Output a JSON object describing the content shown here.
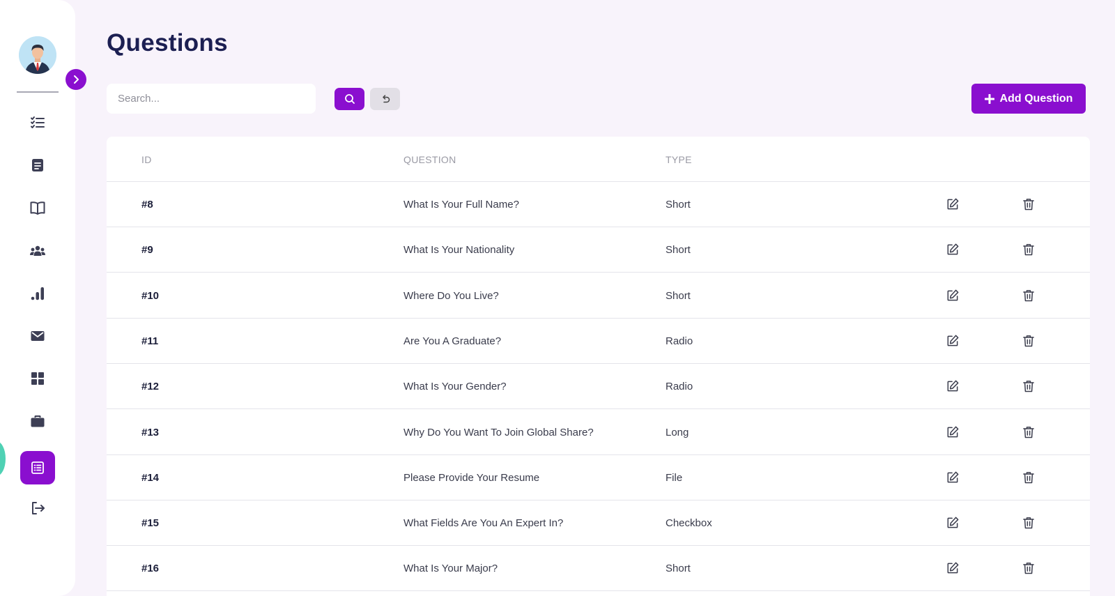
{
  "page": {
    "title": "Questions"
  },
  "search": {
    "placeholder": "Search..."
  },
  "toolbar": {
    "add_label": "Add Question"
  },
  "colors": {
    "accent": "#8a0fcf",
    "title": "#1c1f52",
    "background": "#f8f3fb"
  },
  "sidebar": {
    "items": [
      {
        "icon": "checklist-icon"
      },
      {
        "icon": "note-icon"
      },
      {
        "icon": "book-icon"
      },
      {
        "icon": "users-icon"
      },
      {
        "icon": "bar-chart-icon"
      },
      {
        "icon": "mail-icon"
      },
      {
        "icon": "dashboard-grid-icon"
      },
      {
        "icon": "briefcase-icon"
      },
      {
        "icon": "questions-list-icon",
        "active": true
      },
      {
        "icon": "logout-icon"
      }
    ]
  },
  "table": {
    "headers": {
      "id": "ID",
      "question": "QUESTION",
      "type": "TYPE"
    },
    "rows": [
      {
        "id": "#8",
        "question": "What Is Your Full Name?",
        "type": "Short"
      },
      {
        "id": "#9",
        "question": "What Is Your Nationality",
        "type": "Short"
      },
      {
        "id": "#10",
        "question": "Where Do You Live?",
        "type": "Short"
      },
      {
        "id": "#11",
        "question": "Are You A Graduate?",
        "type": "Radio"
      },
      {
        "id": "#12",
        "question": "What Is Your Gender?",
        "type": "Radio"
      },
      {
        "id": "#13",
        "question": "Why Do You Want To Join Global Share?",
        "type": "Long"
      },
      {
        "id": "#14",
        "question": "Please Provide Your Resume",
        "type": "File"
      },
      {
        "id": "#15",
        "question": "What Fields Are You An Expert In?",
        "type": "Checkbox"
      },
      {
        "id": "#16",
        "question": "What Is Your Major?",
        "type": "Short"
      }
    ]
  }
}
